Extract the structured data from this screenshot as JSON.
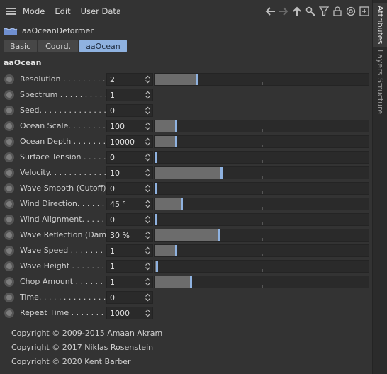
{
  "menubar": {
    "items": [
      "Mode",
      "Edit",
      "User Data"
    ]
  },
  "toolbar_icons": [
    "arrow-left-icon",
    "arrow-right-icon",
    "arrow-up-icon",
    "search-icon",
    "filter-icon",
    "lock-icon",
    "target-icon",
    "new-panel-icon"
  ],
  "object": {
    "name": "aaOceanDeformer"
  },
  "tabs": [
    {
      "label": "Basic",
      "active": false
    },
    {
      "label": "Coord.",
      "active": false
    },
    {
      "label": "aaOcean",
      "active": true
    }
  ],
  "section": {
    "title": "aaOcean"
  },
  "params": [
    {
      "label": "Resolution . . . . . . . . .",
      "value": "2",
      "slider": 0.2
    },
    {
      "label": "Spectrum . . . . . . . . . .",
      "value": "1",
      "slider": null
    },
    {
      "label": "Seed. . . . . . . . . . . . . .",
      "value": "0",
      "slider": null
    },
    {
      "label": "Ocean Scale. . . . . . . .",
      "value": "100",
      "slider": 0.1
    },
    {
      "label": "Ocean Depth . . . . . . . .",
      "value": "10000",
      "slider": 0.1
    },
    {
      "label": "Surface Tension . . . . .",
      "value": "0",
      "slider": 0.0
    },
    {
      "label": "Velocity. . . . . . . . . . . .",
      "value": "10",
      "slider": 0.31
    },
    {
      "label": "Wave Smooth (Cutoff)",
      "value": "0",
      "slider": 0.0
    },
    {
      "label": "Wind Direction. . . . . . .",
      "value": "45 °",
      "slider": 0.125
    },
    {
      "label": "Wind Alignment. . . . . .",
      "value": "0",
      "slider": 0.0
    },
    {
      "label": "Wave Reflection (Damp)",
      "value": "30 %",
      "slider": 0.3
    },
    {
      "label": "Wave Speed . . . . . . . .",
      "value": "1",
      "slider": 0.1
    },
    {
      "label": "Wave Height . . . . . . . .",
      "value": "1",
      "slider": 0.01
    },
    {
      "label": "Chop Amount . . . . . . .",
      "value": "1",
      "slider": 0.17
    },
    {
      "label": "Time. . . . . . . . . . . . . .",
      "value": "0",
      "slider": null
    },
    {
      "label": "Repeat Time . . . . . . .",
      "value": "1000",
      "slider": null
    }
  ],
  "footer": [
    "Copyright © 2009-2015 Amaan Akram",
    "Copyright © 2017 Niklas Rosenstein",
    "Copyright © 2020 Kent Barber"
  ],
  "side_tabs": [
    "Attributes",
    "Layers",
    "Structure"
  ],
  "colors": {
    "accent": "#8fb2e0",
    "panel": "#333333",
    "field": "#2a2a2a",
    "slider_fill": "#6c6c6c"
  }
}
